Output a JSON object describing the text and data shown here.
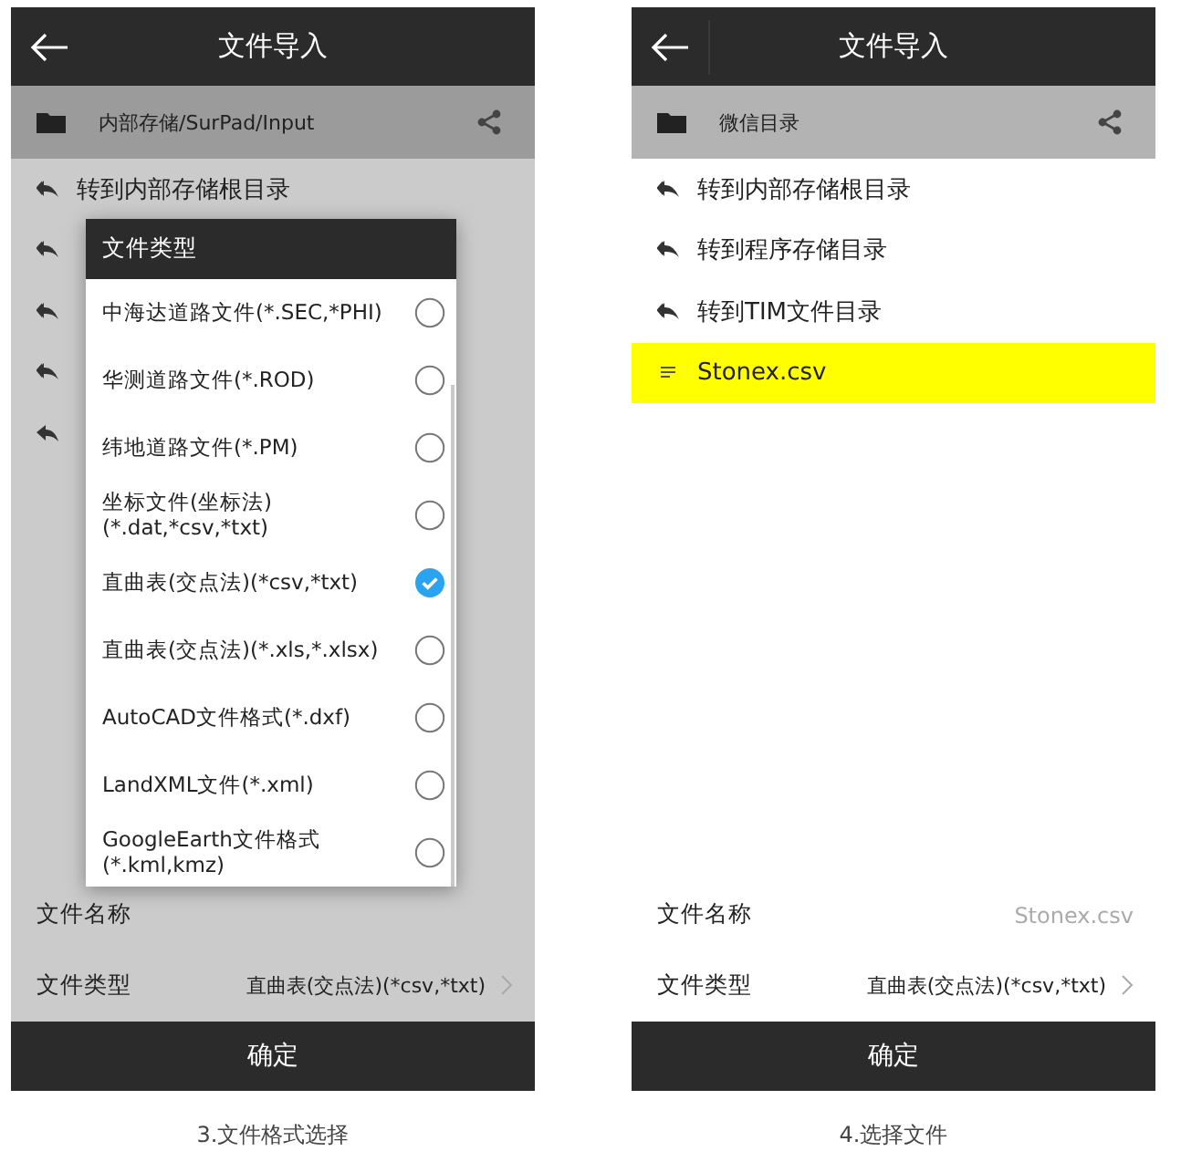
{
  "screens": [
    {
      "dimmed": true,
      "title": "文件导入",
      "path": "内部存储/SurPad/Input",
      "entries": [
        {
          "kind": "goto",
          "label": "转到内部存储根目录",
          "selected": false
        },
        {
          "kind": "goto",
          "selected": false
        },
        {
          "kind": "goto",
          "selected": false
        },
        {
          "kind": "goto",
          "selected": false
        },
        {
          "kind": "back",
          "selected": false
        }
      ],
      "file_name": {
        "label": "文件名称"
      },
      "file_type": {
        "label": "文件类型",
        "value": "直曲表(交点法)(*csv,*txt)"
      },
      "confirm": "确定",
      "dialog": {
        "title": "文件类型",
        "options": [
          {
            "label": "中海达道路文件(*.SEC,*PHI)",
            "selected": false
          },
          {
            "label": "华测道路文件(*.ROD)",
            "selected": false
          },
          {
            "label": "纬地道路文件(*.PM)",
            "selected": false
          },
          {
            "label": "坐标文件(坐标法)\n(*.dat,*csv,*txt)",
            "selected": false
          },
          {
            "label": "直曲表(交点法)(*csv,*txt)",
            "selected": true
          },
          {
            "label": "直曲表(交点法)(*.xls,*.xlsx)",
            "selected": false
          },
          {
            "label": "AutoCAD文件格式(*.dxf)",
            "selected": false
          },
          {
            "label": "LandXML文件(*.xml)",
            "selected": false
          },
          {
            "label": "GoogleEarth文件格式\n(*.kml,kmz)",
            "selected": false
          }
        ]
      },
      "caption": "3.文件格式选择"
    },
    {
      "dimmed": false,
      "title": "文件导入",
      "path": "微信目录",
      "entries": [
        {
          "kind": "goto",
          "label": "转到内部存储根目录",
          "selected": false
        },
        {
          "kind": "goto",
          "label": "转到程序存储目录",
          "selected": false
        },
        {
          "kind": "goto",
          "label": "转到TIM文件目录",
          "selected": false
        },
        {
          "kind": "file",
          "label": "Stonex.csv",
          "selected": true
        }
      ],
      "file_name": {
        "label": "文件名称",
        "value": "Stonex.csv"
      },
      "file_type": {
        "label": "文件类型",
        "value": "直曲表(交点法)(*csv,*txt)"
      },
      "confirm": "确定",
      "caption": "4.选择文件"
    }
  ]
}
